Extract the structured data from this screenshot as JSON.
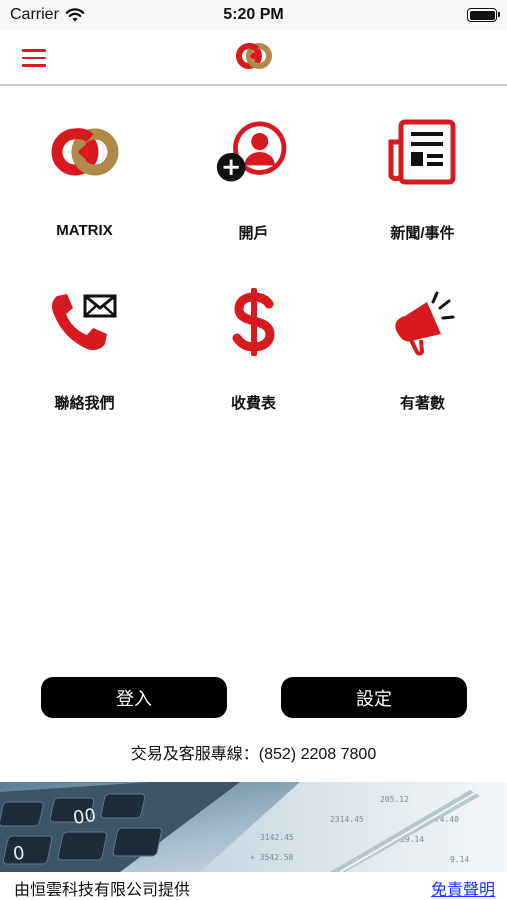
{
  "status_bar": {
    "carrier": "Carrier",
    "time": "5:20 PM",
    "icons": [
      "wifi-icon",
      "battery-icon"
    ]
  },
  "nav": {
    "menu_icon": "hamburger-menu-icon",
    "logo_icon": "brand-logo-icon"
  },
  "colors": {
    "brand_red": "#d71920",
    "brand_gold": "#b08a4a",
    "button_black": "#000000",
    "link_blue": "#1a35ff"
  },
  "tiles": [
    {
      "label": "MATRIX",
      "icon": "matrix-logo-icon"
    },
    {
      "label": "開戶",
      "icon": "add-user-icon"
    },
    {
      "label": "新聞/事件",
      "icon": "newspaper-icon"
    },
    {
      "label": "聯絡我們",
      "icon": "phone-mail-icon"
    },
    {
      "label": "收費表",
      "icon": "dollar-icon"
    },
    {
      "label": "有著數",
      "icon": "megaphone-icon"
    }
  ],
  "buttons": {
    "login": "登入",
    "settings": "設定"
  },
  "hotline": "交易及客服專線：(852) 2208 7800",
  "banner": {
    "icon": "calculator-documents-image"
  },
  "footer": {
    "provider": "由恒雲科技有限公司提供",
    "disclaimer": "免責聲明"
  }
}
